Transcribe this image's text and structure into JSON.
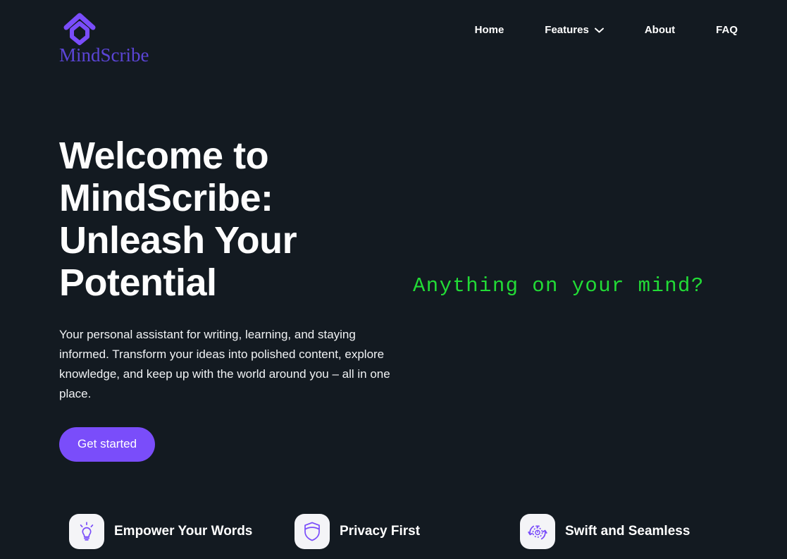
{
  "brand": {
    "name": "MindScribe",
    "icon": "mindscribe-logo-icon",
    "color": "#5b45d6"
  },
  "nav": {
    "items": [
      {
        "label": "Home",
        "has_chevron": false
      },
      {
        "label": "Features",
        "has_chevron": true
      },
      {
        "label": "About",
        "has_chevron": false
      },
      {
        "label": "FAQ",
        "has_chevron": false
      }
    ]
  },
  "hero": {
    "title": "Welcome to MindScribe: Unleash Your Potential",
    "subtitle": "Your personal assistant for writing, learning, and staying informed. Transform your ideas into polished content, explore knowledge, and keep up with the world around you – all in one place.",
    "cta_label": "Get started",
    "cta_color": "#7a4dfa",
    "prompt_text": "Anything on your mind?",
    "prompt_color": "#22db36"
  },
  "features": [
    {
      "label": "Empower Your Words",
      "icon": "lightbulb-icon"
    },
    {
      "label": "Privacy First",
      "icon": "shield-icon"
    },
    {
      "label": "Swift and Seamless",
      "icon": "stopwatch-refresh-icon"
    }
  ],
  "theme": {
    "background": "#131a21",
    "accent": "#7a4dfa",
    "text": "#ffffff"
  }
}
